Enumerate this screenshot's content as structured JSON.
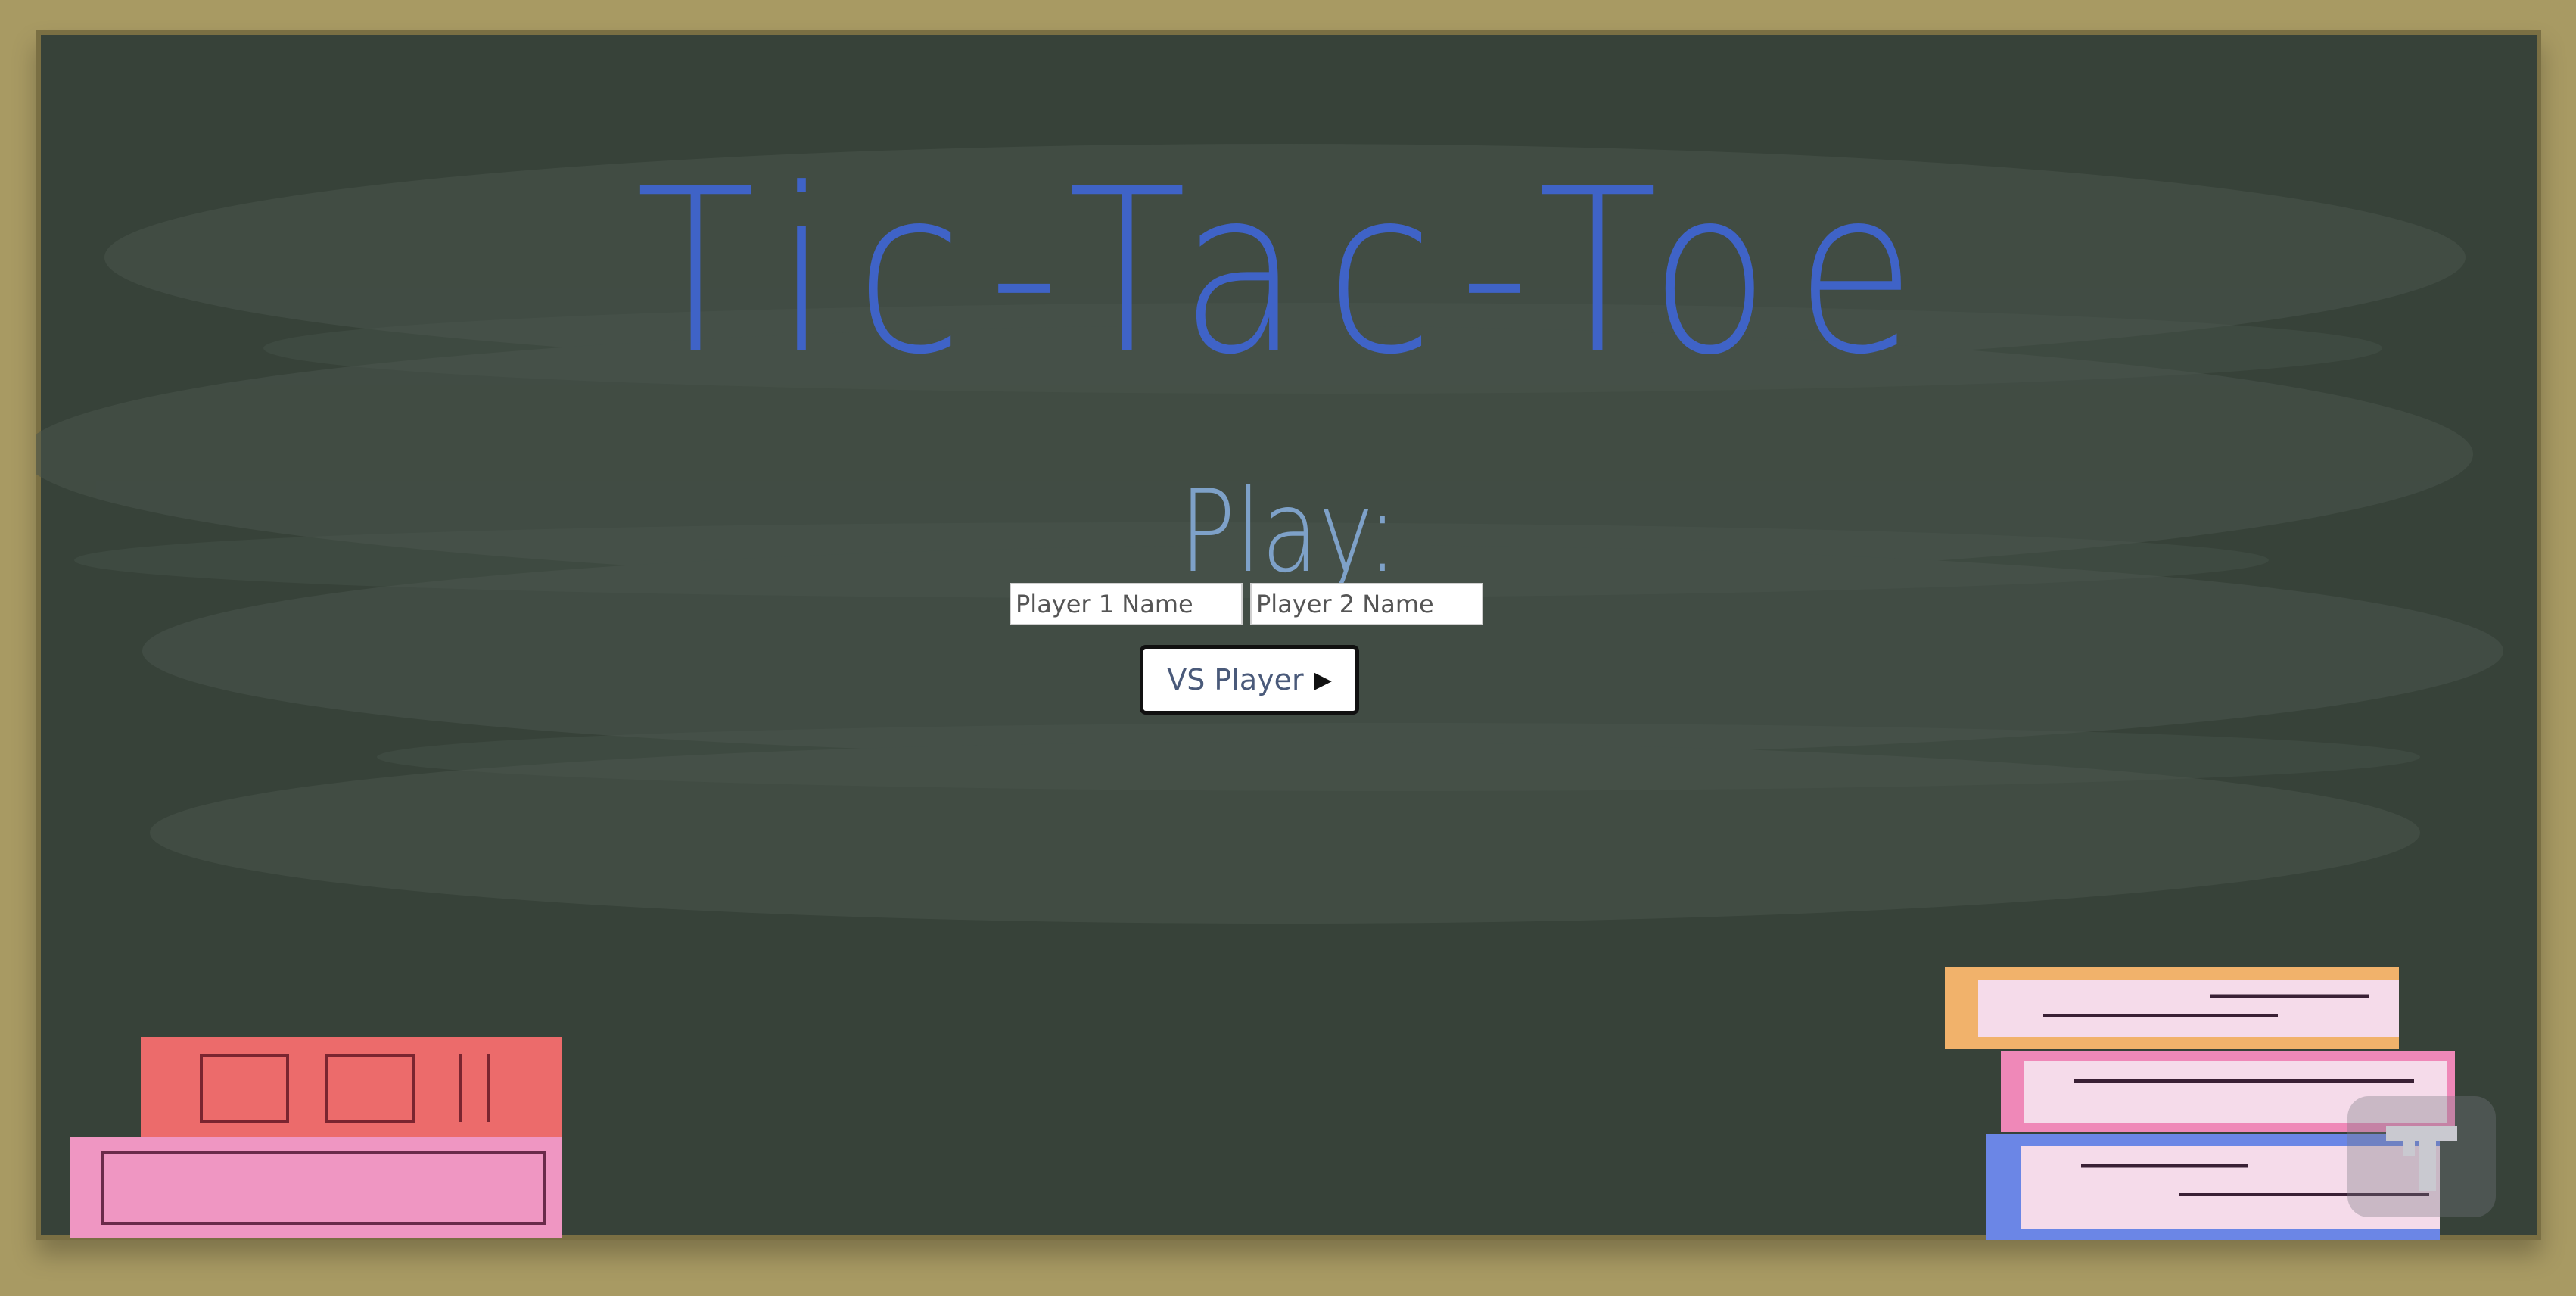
{
  "title": "Tic-Tac-Toe",
  "subtitle": "Play:",
  "player1": {
    "placeholder": "Player 1 Name",
    "value": ""
  },
  "player2": {
    "placeholder": "Player 2 Name",
    "value": ""
  },
  "play_button": {
    "label": "VS Player",
    "icon": "play-triangle-icon"
  },
  "colors": {
    "frame": "#a89a63",
    "board": "#374239",
    "title": "#3f63c7",
    "subtitle": "#7ea1c8"
  }
}
